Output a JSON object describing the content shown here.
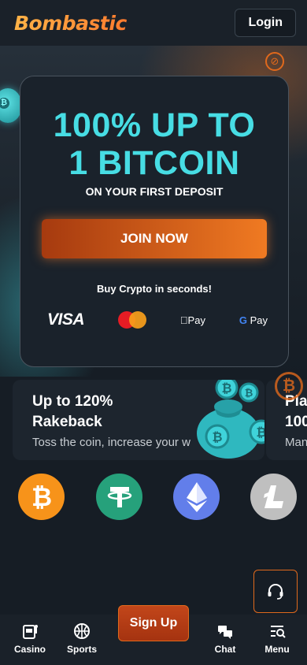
{
  "header": {
    "logo": "Bombastic",
    "login_label": "Login"
  },
  "promo": {
    "title_line1": "100% UP TO",
    "title_line2": "1 BITCOIN",
    "subtitle": "ON YOUR FIRST DEPOSIT",
    "cta_label": "JOIN NOW",
    "crypto_text": "Buy Crypto in seconds!",
    "payments": {
      "visa": "VISA",
      "apple_pay": "Pay",
      "google_pay": "Pay"
    }
  },
  "cards": [
    {
      "title": "Up to 120%\nRakeback",
      "description": "Toss the coin, increase your w"
    },
    {
      "title": "Pla\n100",
      "description": "Man"
    }
  ],
  "coins": [
    "bitcoin-icon",
    "tether-icon",
    "ethereum-icon",
    "litecoin-icon"
  ],
  "nav": {
    "casino": "Casino",
    "sports": "Sports",
    "signup": "Sign Up",
    "chat": "Chat",
    "menu": "Menu"
  },
  "colors": {
    "accent": "#e0691c",
    "cyan": "#47dde4",
    "bg": "#161d25"
  }
}
